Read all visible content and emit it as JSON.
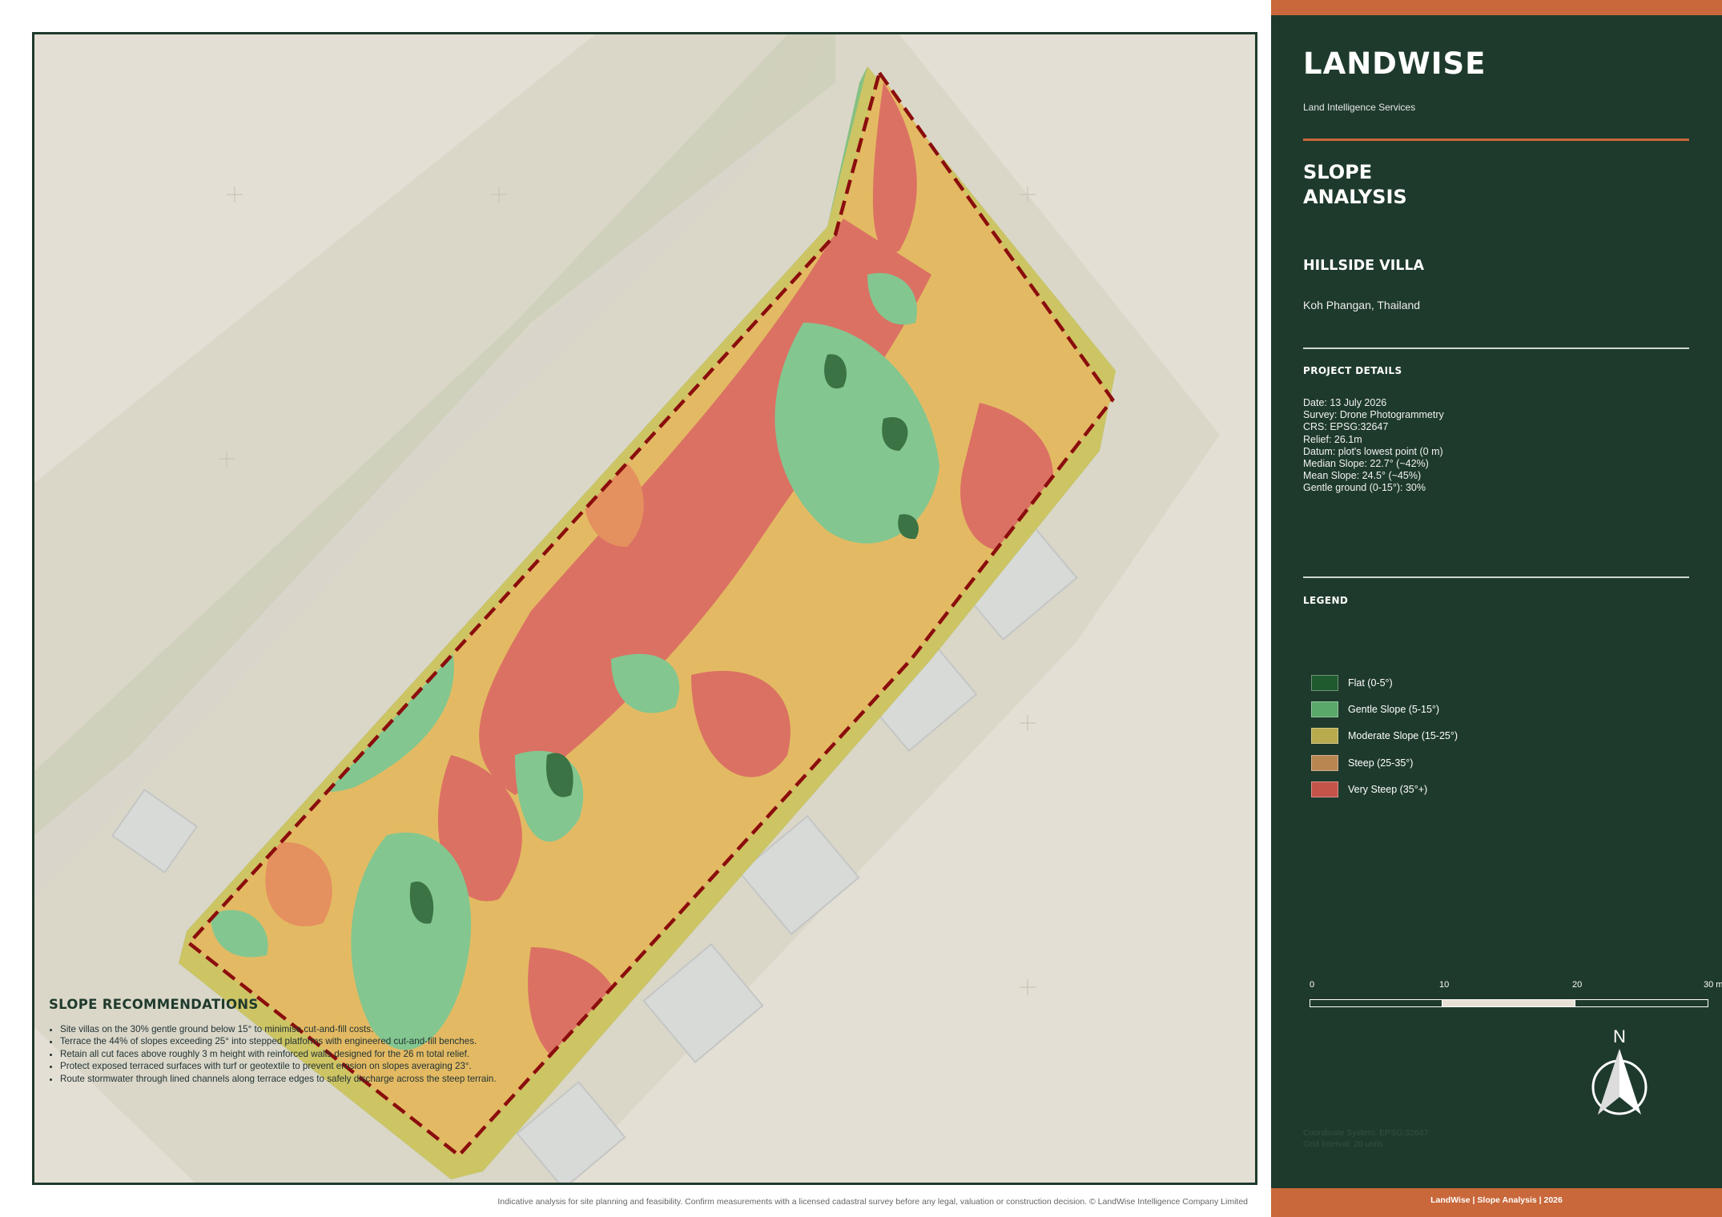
{
  "brand": {
    "name": "LANDWISE",
    "tagline": "Land Intelligence Services"
  },
  "report": {
    "title_line1": "SLOPE",
    "title_line2": "ANALYSIS"
  },
  "project": {
    "name": "HILLSIDE VILLA",
    "location": "Koh Phangan, Thailand"
  },
  "details": {
    "heading": "PROJECT DETAILS",
    "rows": [
      "Date:  13 July 2026",
      "Survey:  Drone Photogrammetry",
      "CRS:  EPSG:32647",
      "Relief:  26.1m",
      "Datum:  plot's lowest point (0 m)",
      "Median Slope:  22.7°  (~42%)",
      "Mean Slope:  24.5°  (~45%)",
      "Gentle ground (0-15°):  30%"
    ]
  },
  "legend": {
    "heading": "LEGEND",
    "items": [
      {
        "label": "Flat (0-5°)",
        "color": "#1f5a2e"
      },
      {
        "label": "Gentle Slope (5-15°)",
        "color": "#5aa86a"
      },
      {
        "label": "Moderate Slope (15-25°)",
        "color": "#b8ab4e"
      },
      {
        "label": "Steep (25-35°)",
        "color": "#b98652"
      },
      {
        "label": "Very Steep (35°+)",
        "color": "#c4544a"
      }
    ]
  },
  "scale_bar": {
    "ticks": [
      "0",
      "10",
      "20",
      "30 m"
    ]
  },
  "north_arrow": {
    "label": "N",
    "icon": "north-arrow-icon"
  },
  "coord_info": {
    "line1": "Coordinate System: EPSG:32647",
    "line2": "Grid Interval: 20 units"
  },
  "footer": {
    "bar_text": "LandWise  |  Slope Analysis  |  2026"
  },
  "recommendations": {
    "heading": "SLOPE RECOMMENDATIONS",
    "items": [
      "Site villas on the 30% gentle ground below 15° to minimise cut-and-fill costs.",
      "Terrace the 44% of slopes exceeding 25° into stepped platforms with engineered cut-and-fill benches.",
      "Retain all cut faces above roughly 3 m height with reinforced walls designed for the 26 m total relief.",
      "Protect exposed terraced surfaces with turf or geotextile to prevent erosion on slopes averaging 23°.",
      "Route stormwater through lined channels along terrace edges to safely discharge across the steep terrain."
    ]
  },
  "disclaimer": "Indicative analysis for site planning and feasibility. Confirm measurements with a licensed cadastral survey before any legal, valuation or construction decision. © LandWise Intelligence Company Limited",
  "colors": {
    "panel": "#1e3a2c",
    "accent": "#c8683b",
    "boundary": "#8b0d0d"
  }
}
